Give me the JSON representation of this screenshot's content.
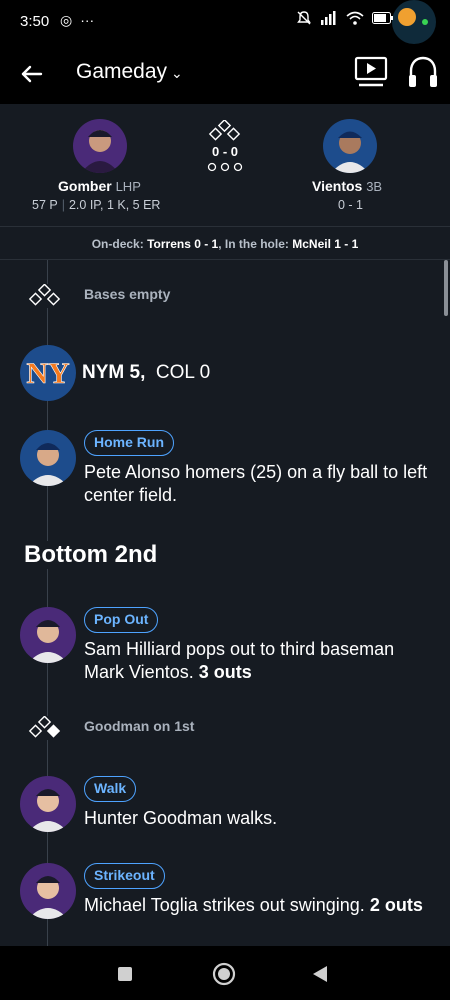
{
  "status_bar": {
    "time": "3:50",
    "left_icons": [
      "at-sign-icon",
      "more-dots-icon"
    ],
    "right_icons": [
      "mute-icon",
      "signal-icon",
      "wifi-icon",
      "battery-icon"
    ]
  },
  "header": {
    "title": "Gameday",
    "back_icon": "arrow-left-icon",
    "tv_icon": "tv-play-icon",
    "audio_icon": "headphones-icon"
  },
  "matchup": {
    "pitcher": {
      "name": "Gomber",
      "pos": "LHP",
      "pitches": "57 P",
      "line": "2.0 IP, 1 K, 5 ER"
    },
    "count": "0 - 0",
    "batter": {
      "name": "Vientos",
      "pos": "3B",
      "line": "0 - 1"
    },
    "ondeck_label": "On-deck:",
    "ondeck_value": "Torrens 0 - 1",
    "hole_label": ", In the hole:",
    "hole_value": "McNeil 1 - 1"
  },
  "feed": {
    "bases_1": "Bases empty",
    "score": {
      "lead": "NYM 5,",
      "trail": "COL 0"
    },
    "play_1": {
      "badge": "Home Run",
      "text": "Pete Alonso homers (25) on a fly ball to left center field."
    },
    "inning": "Bottom 2nd",
    "play_2": {
      "badge": "Pop Out",
      "text": "Sam Hilliard pops out to third baseman Mark Vientos.",
      "outs": "3 outs"
    },
    "bases_2": "Goodman on 1st",
    "play_3": {
      "badge": "Walk",
      "text": "Hunter Goodman walks."
    },
    "play_4": {
      "badge": "Strikeout",
      "text": "Michael Toglia strikes out swinging.",
      "outs": "2 outs"
    }
  },
  "colors": {
    "accent": "#4ea3ff",
    "panel": "#161b22",
    "nym": "#1d4c8c",
    "col": "#4a2a78"
  }
}
